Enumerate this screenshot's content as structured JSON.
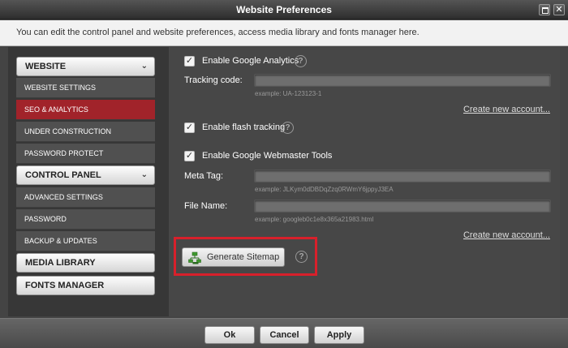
{
  "window": {
    "title": "Website Preferences"
  },
  "info": {
    "text": "You can edit the control panel and website preferences, access media library and fonts manager here."
  },
  "sidebar": {
    "website_header": "WEBSITE",
    "website_items": [
      {
        "label": "WEBSITE SETTINGS"
      },
      {
        "label": "SEO & ANALYTICS",
        "active": true
      },
      {
        "label": "UNDER CONSTRUCTION"
      },
      {
        "label": "PASSWORD PROTECT"
      }
    ],
    "control_header": "CONTROL PANEL",
    "control_items": [
      {
        "label": "ADVANCED SETTINGS"
      },
      {
        "label": "PASSWORD"
      },
      {
        "label": "BACKUP & UPDATES"
      }
    ],
    "media_header": "MEDIA LIBRARY",
    "fonts_header": "FONTS MANAGER"
  },
  "main": {
    "analytics": {
      "label": "Enable Google Analytics",
      "checked": true,
      "tracking_label": "Tracking code:",
      "tracking_value": "",
      "hint": "example: UA-123123-1",
      "link": "Create new account..."
    },
    "flash": {
      "label": "Enable flash tracking",
      "checked": true
    },
    "webmaster": {
      "label": "Enable Google Webmaster Tools",
      "checked": true,
      "meta_label": "Meta Tag:",
      "meta_value": "",
      "meta_hint": "example: JLKym0dDBDqZzq0RWmY6jppyJ3EA",
      "file_label": "File Name:",
      "file_value": "",
      "file_hint": "example: googleb0c1e8x365a21983.html",
      "link": "Create new account..."
    },
    "sitemap_button": "Generate Sitemap"
  },
  "footer": {
    "ok": "Ok",
    "cancel": "Cancel",
    "apply": "Apply"
  },
  "icons": {
    "check": "check-icon",
    "help": "help-icon",
    "sitemap": "sitemap-icon",
    "chevron": "chevron-down-icon"
  },
  "colors": {
    "active": "#a1232a",
    "highlight": "#d8202b"
  }
}
